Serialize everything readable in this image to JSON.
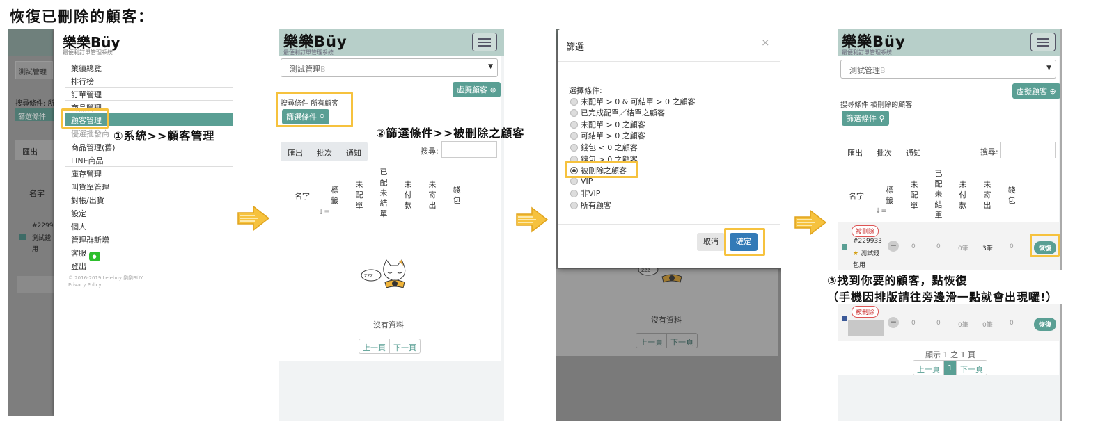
{
  "page_title": "恢復已刪除的顧客：",
  "steps": {
    "step1": "①系統>>顧客管理",
    "step2": "②篩選條件>>被刪除之顧客",
    "step3_line1": "③找到你要的顧客，點恢復",
    "step3_line2": "（手機因排版請往旁邊滑一點就會出現囉!）"
  },
  "brand": {
    "logo": "樂樂Büy",
    "slogan": "最便利訂單管理系統"
  },
  "panel1": {
    "bg_select": "測試管理",
    "bg_search_label": "搜尋條件",
    "bg_search_value": "所",
    "bg_filter_btn": "篩選條件",
    "bg_tab": "匯出",
    "bg_col": "名字",
    "bg_row_id": "#22993",
    "bg_row_name": "測試錢",
    "bg_row_tag": "用",
    "menu": [
      "業績總覽",
      "排行榜",
      "訂單管理",
      "商品管理",
      "顧客管理",
      "優選批發商",
      "商品管理(舊)",
      "LINE商品",
      "庫存管理",
      "叫貨單管理",
      "對帳/出貨",
      "設定",
      "個人",
      "管理群新增",
      "客服",
      "登出"
    ],
    "footer": "© 2016-2019 Lelebuy 樂樂BÜY",
    "privacy": "Privacy Policy"
  },
  "panel2": {
    "select": "測試管理",
    "select_suffix": "B",
    "virtual_btn": "虛擬顧客",
    "search_label": "搜尋條件",
    "search_value": "所有顧客",
    "filter_btn": "篩選條件",
    "tabs": [
      "匯出",
      "批次",
      "通知"
    ],
    "search_text": "搜尋:",
    "columns": [
      "名字",
      "標籤",
      "未配單",
      "已配未結單",
      "未付款",
      "未寄出",
      "錢包"
    ],
    "empty": "沒有資料",
    "prev": "上一頁",
    "next": "下一頁"
  },
  "panel3": {
    "modal_title": "篩選",
    "close": "×",
    "label": "選擇條件:",
    "options": [
      "未配單 > 0 & 可結單 > 0 之顧客",
      "已完成配單／結單之顧客",
      "未配單 > 0 之顧客",
      "可結單 > 0 之顧客",
      "錢包 < 0 之顧客",
      "錢包 > 0 之顧客",
      "被刪除之顧客",
      "VIP",
      "非VIP",
      "所有顧客"
    ],
    "selected_index": 6,
    "cancel": "取消",
    "confirm": "確定",
    "bg_empty": "沒有資料",
    "bg_prev": "上一頁",
    "bg_next": "下一頁"
  },
  "panel4": {
    "select": "測試管理",
    "select_suffix": "B",
    "virtual_btn": "虛擬顧客",
    "search_label": "搜尋條件",
    "search_value": "被刪除的顧客",
    "filter_btn": "篩選條件",
    "tabs": [
      "匯出",
      "批次",
      "通知"
    ],
    "search_text": "搜尋:",
    "columns": [
      "名字",
      "標籤",
      "未配單",
      "已配未結單",
      "未付款",
      "未寄出",
      "錢包"
    ],
    "rows": [
      {
        "badge": "被刪除",
        "id": "#229933",
        "name": "測試錢",
        "tag": "包用",
        "c1": "0",
        "c2": "0",
        "c3": "0筆",
        "c4": "3筆",
        "c5": "0",
        "action": "恢復"
      },
      {
        "badge": "被刪除",
        "id": "",
        "name": "",
        "tag": "",
        "c1": "0",
        "c2": "0",
        "c3": "0筆",
        "c4": "0筆",
        "c5": "0",
        "action": "恢復"
      }
    ],
    "showing": "顯示 1 之 1 頁",
    "prev": "上一頁",
    "page": "1",
    "next": "下一頁"
  },
  "colors": {
    "accent": "#5a9f94",
    "appbar": "#b7cfc9",
    "highlight": "#f6c23e",
    "modal_primary": "#337ab7"
  }
}
